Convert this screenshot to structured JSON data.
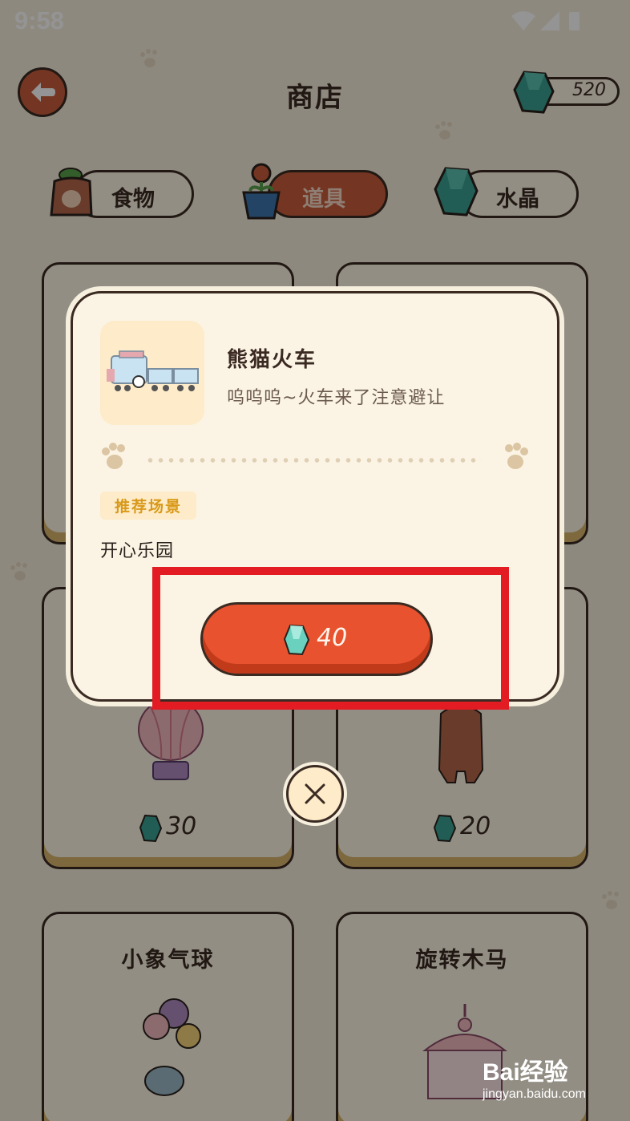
{
  "status_bar": {
    "time": "9:58"
  },
  "header": {
    "title": "商店",
    "crystal_count": "520"
  },
  "tabs": [
    {
      "label": "食物",
      "active": false
    },
    {
      "label": "道具",
      "active": true
    },
    {
      "label": "水晶",
      "active": false
    }
  ],
  "cards": [
    {
      "price": "30"
    },
    {
      "price": "20"
    },
    {
      "title": "小象气球"
    },
    {
      "title": "旋转木马"
    }
  ],
  "dialog": {
    "item_name": "熊猫火车",
    "item_desc": "呜呜呜~火车来了注意避让",
    "scene_tag": "推荐场景",
    "scene_value": "开心乐园",
    "price": "40"
  },
  "watermark": {
    "logo": "Bai经验",
    "url": "jingyan.baidu.com"
  },
  "colors": {
    "accent": "#e8522e",
    "highlight": "#e31b23",
    "tab_active": "#c85d3d",
    "crystal": "#3aa191"
  }
}
